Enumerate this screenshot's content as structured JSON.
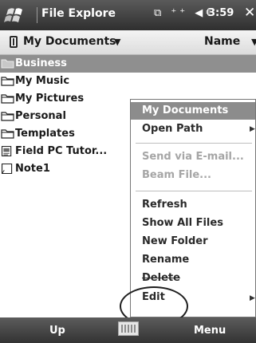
{
  "title_bar": {
    "app_title": "File Explore",
    "status_icons": "⧉ ⁺⁺ ◀€",
    "clock": "3:59",
    "close": "✕"
  },
  "location_bar": {
    "location": "My Documents",
    "sort_by": "Name"
  },
  "files": [
    {
      "name": "Business",
      "icon": "folder-icon",
      "selected": true
    },
    {
      "name": "My Music",
      "icon": "folder-icon"
    },
    {
      "name": "My Pictures",
      "icon": "folder-icon"
    },
    {
      "name": "Personal",
      "icon": "folder-icon"
    },
    {
      "name": "Templates",
      "icon": "folder-icon"
    },
    {
      "name": "Field PC Tutor...",
      "icon": "document-icon"
    },
    {
      "name": "Note1",
      "icon": "note-icon"
    }
  ],
  "context_menu": {
    "header": "My Documents",
    "items": [
      {
        "label": "Open Path",
        "submenu": true
      },
      {
        "label": "Send via E-mail...",
        "disabled": true
      },
      {
        "label": "Beam File...",
        "disabled": true
      },
      {
        "label": "Refresh"
      },
      {
        "label": "Show All Files"
      },
      {
        "label": "New Folder"
      },
      {
        "label": "Rename"
      },
      {
        "label": "Delete"
      },
      {
        "label": "Edit",
        "submenu": true
      }
    ]
  },
  "soft_keys": {
    "left": "Up",
    "right": "Menu"
  },
  "colors": {
    "title_bar": "#3a3a3a",
    "selection": "#8f8f8f",
    "menu_header": "#8c8c8c"
  }
}
